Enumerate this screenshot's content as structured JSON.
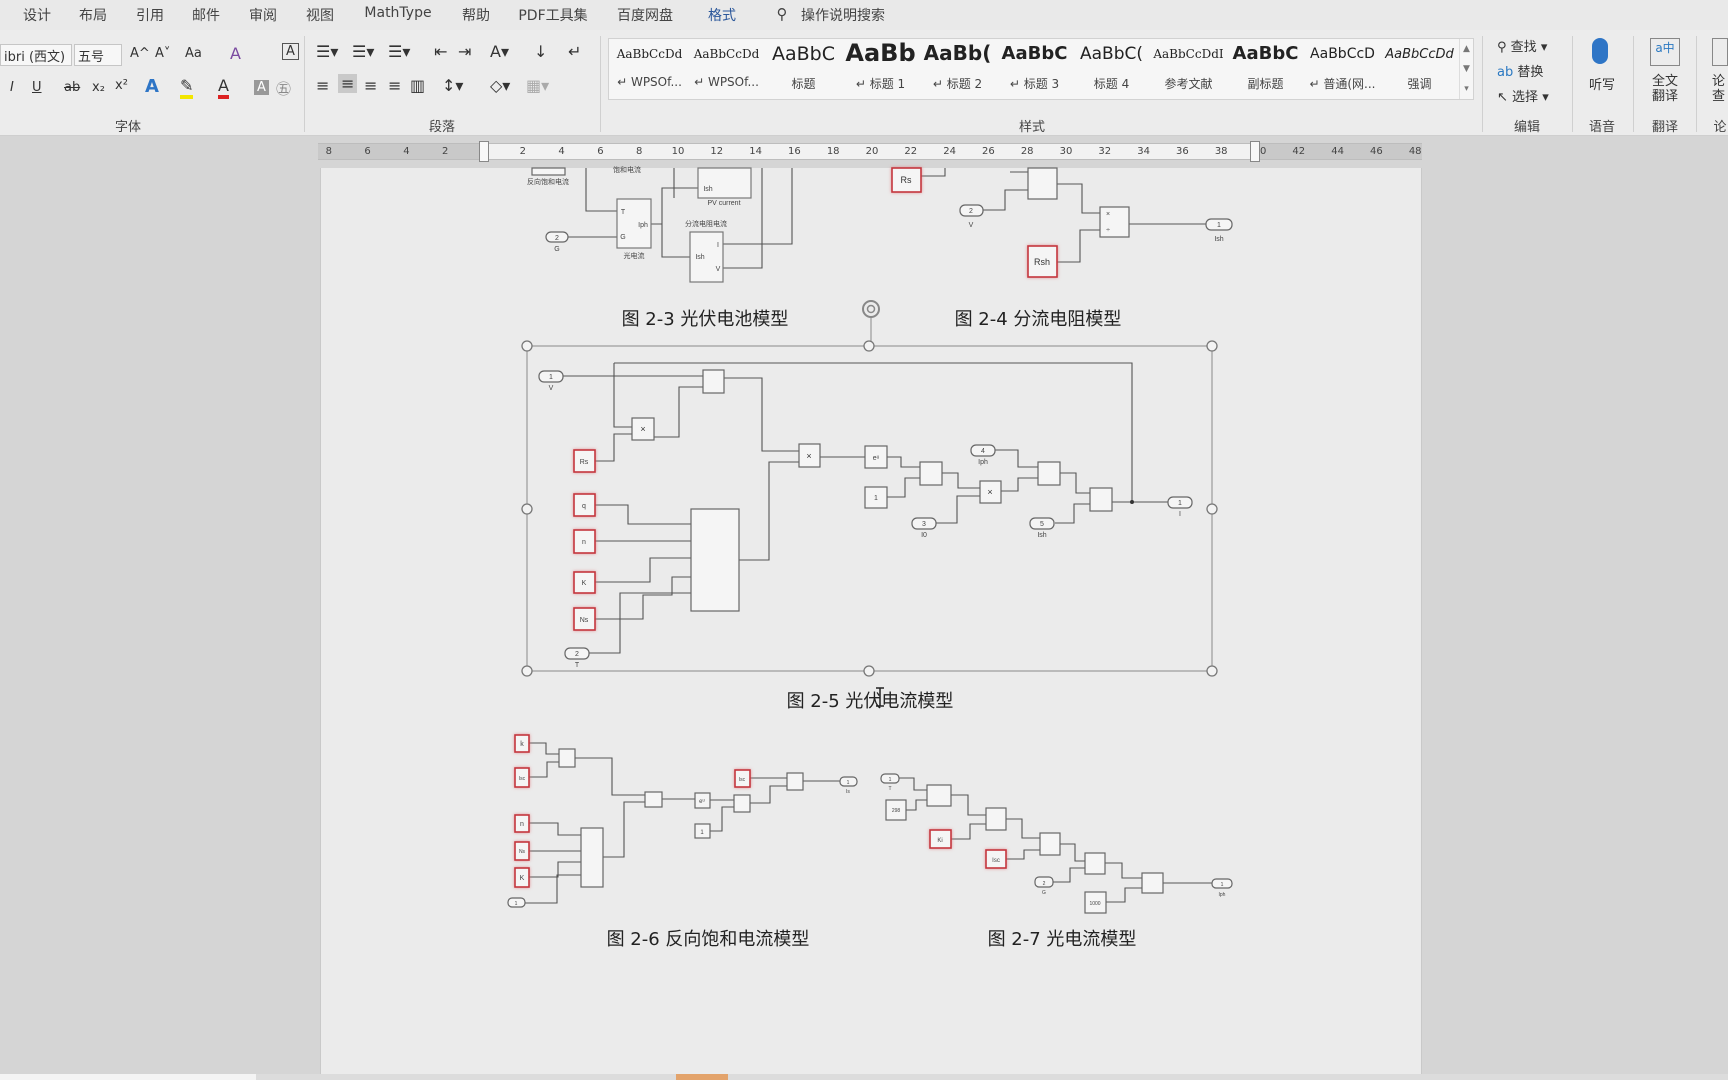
{
  "tabs": [
    "设计",
    "布局",
    "引用",
    "邮件",
    "审阅",
    "视图",
    "MathType",
    "帮助",
    "PDF工具集",
    "百度网盘",
    "格式"
  ],
  "active_tab": "格式",
  "tell_me": "操作说明搜索",
  "accent_color": "#2b579a",
  "font_group": {
    "font_name": "ibri (西文)",
    "font_size": "五号",
    "label": "字体",
    "buttons": [
      "A^",
      "A˅",
      "Aa",
      "A",
      "A"
    ],
    "format": [
      "I",
      "U",
      "ab",
      "x₂",
      "x²",
      "A",
      "A",
      "A"
    ]
  },
  "paragraph_group": {
    "label": "段落"
  },
  "styles_group": {
    "label": "样式",
    "items": [
      {
        "sample": "AaBbCcDd",
        "name": "↵ WPSOf..."
      },
      {
        "sample": "AaBbCcDd",
        "name": "↵ WPSOf..."
      },
      {
        "sample": "AaBbC",
        "name": "标题"
      },
      {
        "sample": "AaBb",
        "name": "↵ 标题 1"
      },
      {
        "sample": "AaBb(",
        "name": "↵ 标题 2"
      },
      {
        "sample": "AaBbC",
        "name": "↵ 标题 3"
      },
      {
        "sample": "AaBbC(",
        "name": "标题 4"
      },
      {
        "sample": "AaBbCcDdI",
        "name": "参考文献"
      },
      {
        "sample": "AaBbC",
        "name": "副标题"
      },
      {
        "sample": "AaBbCcD",
        "name": "↵ 普通(网..."
      },
      {
        "sample": "AaBbCcDd",
        "name": "强调"
      }
    ]
  },
  "editing_group": {
    "label": "编辑",
    "find": "查找",
    "replace": "替换",
    "select": "选择"
  },
  "voice_group": {
    "label": "语音",
    "dictate": "听写"
  },
  "translate_group": {
    "label": "翻译",
    "full": "全文",
    "full2": "翻译"
  },
  "paper_group": {
    "label": "论",
    "btn1": "论",
    "btn2": "查"
  },
  "ruler": [
    "8",
    "6",
    "4",
    "2",
    "",
    "2",
    "4",
    "6",
    "8",
    "10",
    "12",
    "14",
    "16",
    "18",
    "20",
    "22",
    "24",
    "26",
    "28",
    "30",
    "32",
    "34",
    "36",
    "38",
    "40",
    "42",
    "44",
    "46",
    "48"
  ],
  "figures": {
    "fig3": {
      "caption": "图 2-3  光伏电池模型",
      "labels": {
        "rsat": "反向饱和电流",
        "sat": "饱和电流",
        "pv": "PV current",
        "ish": "Ish",
        "photo": "光电流",
        "T": "T",
        "G": "G",
        "Iph": "Iph",
        "shunt": "分流电阻电流",
        "I": "I",
        "V": "V",
        "gport": "2",
        "glabel": "G"
      }
    },
    "fig4": {
      "caption": "图 2-4 分流电阻模型",
      "labels": {
        "Rs": "Rs",
        "Rsh": "Rsh",
        "vport": "2",
        "vlabel": "V",
        "out": "1",
        "outlabel": "Ish",
        "x": "×",
        "div": "÷"
      }
    },
    "fig5": {
      "caption": "图 2-5  光伏电流模型",
      "labels": {
        "p1": "1",
        "V": "V",
        "p2": "2",
        "T": "T",
        "Rs": "Rs",
        "q": "q",
        "n": "n",
        "K": "K",
        "Ns": "Ns",
        "x": "×",
        "exp": "eᵘ",
        "one": "1",
        "p3": "3",
        "I0": "I0",
        "p4": "4",
        "Iph": "Iph",
        "p5": "5",
        "Ish": "Ish",
        "out": "1",
        "I": "I"
      }
    },
    "fig6": {
      "caption": "图 2-6  反向饱和电流模型",
      "labels": {
        "c1": "k",
        "c2": "Isc",
        "c3": "n",
        "c4": "Ns",
        "c5": "K",
        "c6": "Isc",
        "x": "×",
        "exp": "eᵘ",
        "one": "1",
        "tport": "1",
        "T": "T",
        "out": "1",
        "Is": "Is"
      }
    },
    "fig7": {
      "caption": "图 2-7  光电流模型",
      "labels": {
        "tport": "1",
        "T": "T",
        "c298": "298",
        "Ki": "Ki",
        "Isc": "Isc",
        "gport": "2",
        "G": "G",
        "c1000": "1000",
        "out": "1",
        "Iph": "Iph",
        "x": "×"
      }
    }
  }
}
